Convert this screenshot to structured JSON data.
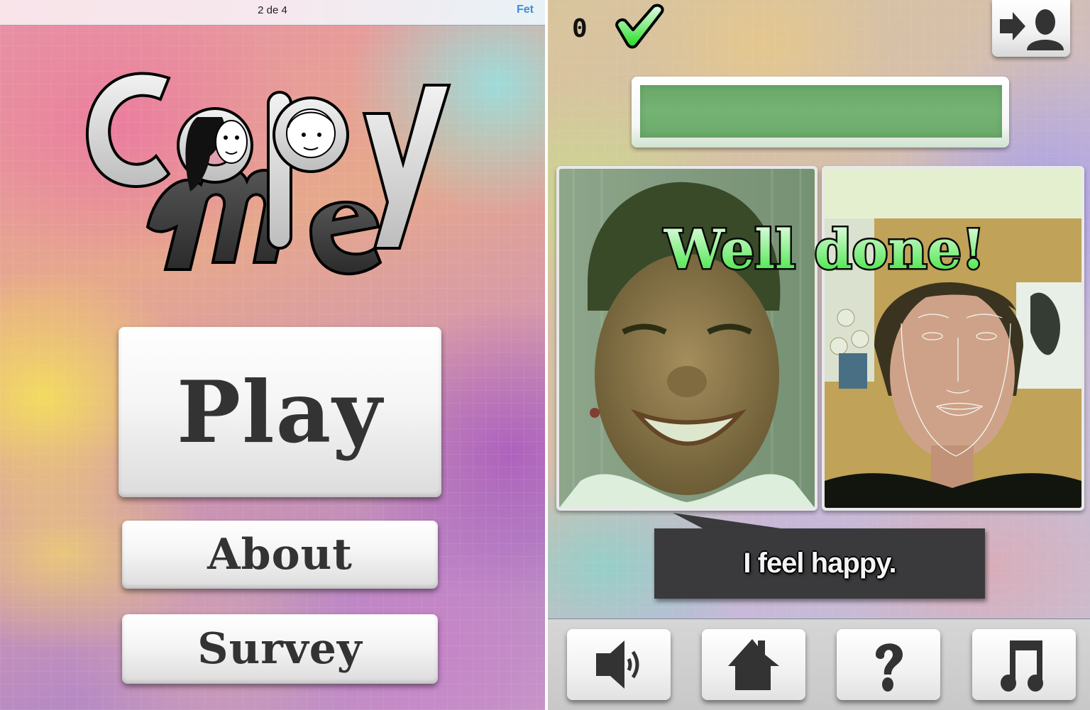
{
  "left_screen": {
    "ios_bar": {
      "page_indicator": "2 de 4",
      "done_label": "Fet",
      "done_color": "#3b8ddb"
    },
    "logo": {
      "word_top": "Copy",
      "word_bottom": "me",
      "icon": "copyme-logo-with-faces"
    },
    "menu": {
      "play_label": "Play",
      "about_label": "About",
      "survey_label": "Survey"
    }
  },
  "right_screen": {
    "score": "0",
    "check_icon": "green-checkmark-icon",
    "switch_user_icon": "switch-user-icon",
    "progress": {
      "fraction": 1.0,
      "color": "#72b072"
    },
    "feedback": "Well done!",
    "feedback_color": "#4cea4c",
    "caption": "I feel happy.",
    "photos": {
      "target": "target-face-photo",
      "player": "player-camera-face-tracked"
    },
    "toolbar": [
      {
        "icon": "speaker-icon",
        "name": "sound"
      },
      {
        "icon": "home-icon",
        "name": "home"
      },
      {
        "icon": "question-icon",
        "name": "help"
      },
      {
        "icon": "music-note-icon",
        "name": "music"
      }
    ]
  }
}
